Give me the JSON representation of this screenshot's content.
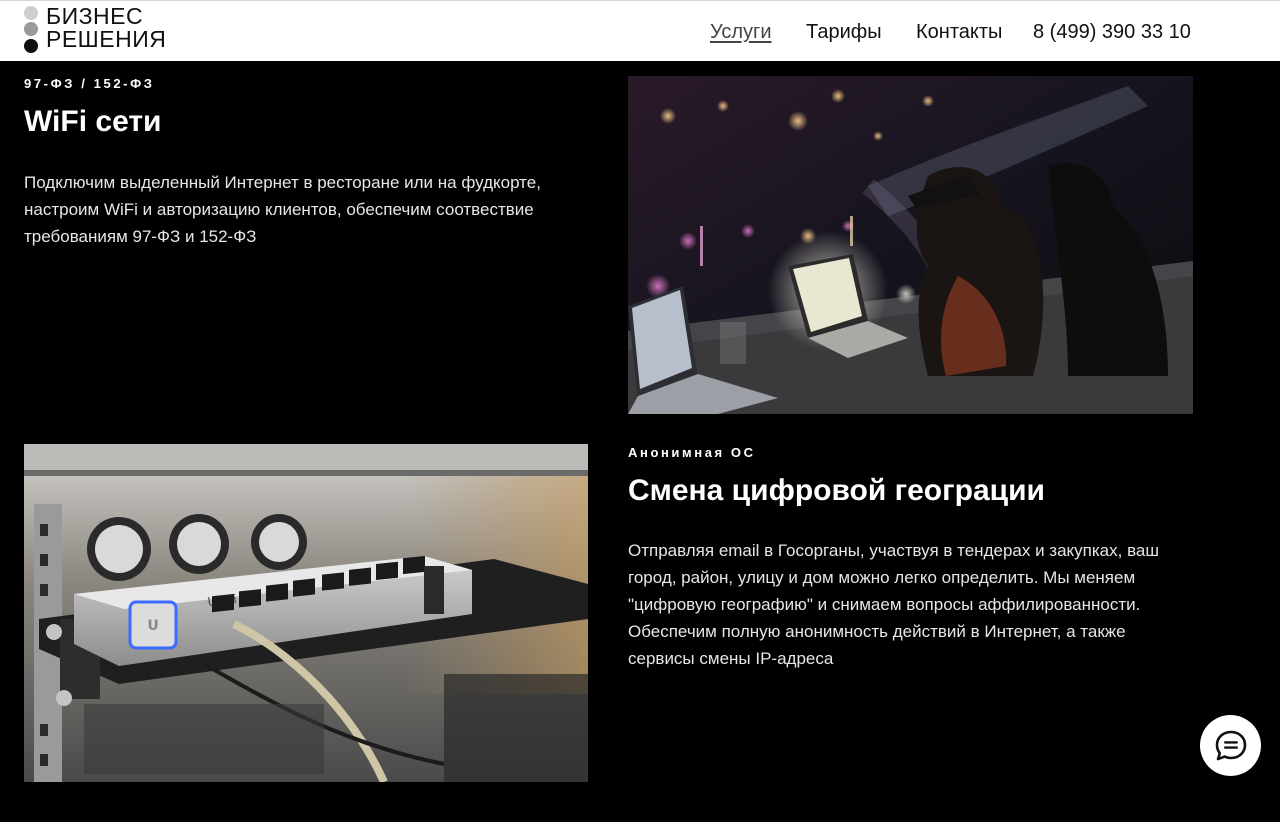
{
  "header": {
    "logo_line1": "БИЗНЕС",
    "logo_line2": "РЕШЕНИЯ",
    "nav": {
      "services": "Услуги",
      "tariffs": "Тарифы",
      "contacts": "Контакты",
      "phone": "8 (499) 390 33 10"
    }
  },
  "wifi": {
    "tag": "97-ФЗ / 152-ФЗ",
    "title": "WiFi сети",
    "text": "Подключим выделенный Интернет в ресторане или на фудкорте, настроим WiFi и авторизацию клиентов, обеспечим соотвествие требованиям 97-ФЗ и 152-ФЗ",
    "image_icon": "cafe-laptop-photo"
  },
  "geo": {
    "tag": "Анонимная ОС",
    "title": "Смена цифровой геограции",
    "text": "Отправляя email в Госорганы, участвуя в тендерах и закупках, ваш город, район, улицу и дом можно легко определить. Мы меняем \"цифровую географию\" и снимаем вопросы аффилированности. Обеспечим полную анонимность действий в Интернет, а также сервисы смены IP-адреса",
    "image_icon": "network-switch-photo",
    "switch_brand": "UniFi"
  },
  "chat": {
    "icon": "chat-bubble-icon"
  },
  "colors": {
    "background": "#000000",
    "header_bg": "#ffffff",
    "text": "#ffffff"
  }
}
